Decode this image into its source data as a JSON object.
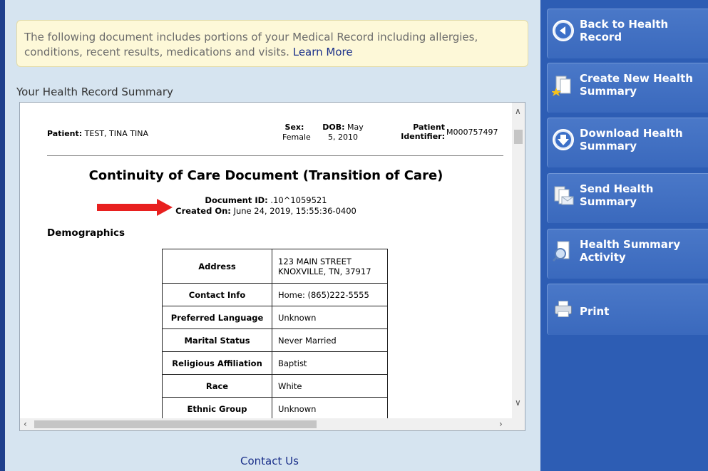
{
  "info": {
    "text": "The following document includes portions of your Medical Record including allergies, conditions, recent results, medications and visits.",
    "learn_more": "Learn More"
  },
  "summary_title": "Your Health Record Summary",
  "document": {
    "patient_label": "Patient:",
    "patient_value": "TEST, TINA TINA",
    "sex_label": "Sex:",
    "sex_value": "Female",
    "dob_label": "DOB:",
    "dob_value_1": "May",
    "dob_value_2": "5, 2010",
    "patient_id_label_1": "Patient",
    "patient_id_label_2": "Identifier:",
    "patient_id_value": "M000757497",
    "title": "Continuity of Care Document (Transition of Care)",
    "doc_id_label": "Document ID:",
    "doc_id_value": ".10^1059521",
    "created_label": "Created On:",
    "created_value": "June 24, 2019, 15:55:36-0400",
    "demographics_heading": "Demographics",
    "demographics": [
      {
        "label": "Address",
        "value": "123 MAIN STREET",
        "value2": "KNOXVILLE, TN, 37917"
      },
      {
        "label": "Contact Info",
        "value": "Home: (865)222-5555",
        "value2": ""
      },
      {
        "label": "Preferred Language",
        "value": "Unknown",
        "value2": ""
      },
      {
        "label": "Marital Status",
        "value": "Never Married",
        "value2": ""
      },
      {
        "label": "Religious Affiliation",
        "value": "Baptist",
        "value2": ""
      },
      {
        "label": "Race",
        "value": "White",
        "value2": ""
      },
      {
        "label": "Ethnic Group",
        "value": "Unknown",
        "value2": ""
      }
    ]
  },
  "contact_us": "Contact Us",
  "sidebar": {
    "items": [
      {
        "label_1": "Back to Health",
        "label_2": "Record",
        "icon": "back-arrow-icon"
      },
      {
        "label_1": "Create New Health",
        "label_2": "Summary",
        "icon": "new-document-star-icon"
      },
      {
        "label_1": "Download Health",
        "label_2": "Summary",
        "icon": "download-arrow-icon"
      },
      {
        "label_1": "Send Health",
        "label_2": "Summary",
        "icon": "send-document-icon"
      },
      {
        "label_1": "Health Summary",
        "label_2": "Activity",
        "icon": "magnifier-document-icon"
      },
      {
        "label_1": "Print",
        "label_2": "",
        "icon": "printer-icon"
      }
    ]
  },
  "colors": {
    "sidebar": "#2d5db4",
    "left_border": "#1f3f8c",
    "background": "#d6e4f0",
    "info_bg": "#fdf8d8",
    "link": "#1a2f8a",
    "arrow": "#e8201f"
  }
}
